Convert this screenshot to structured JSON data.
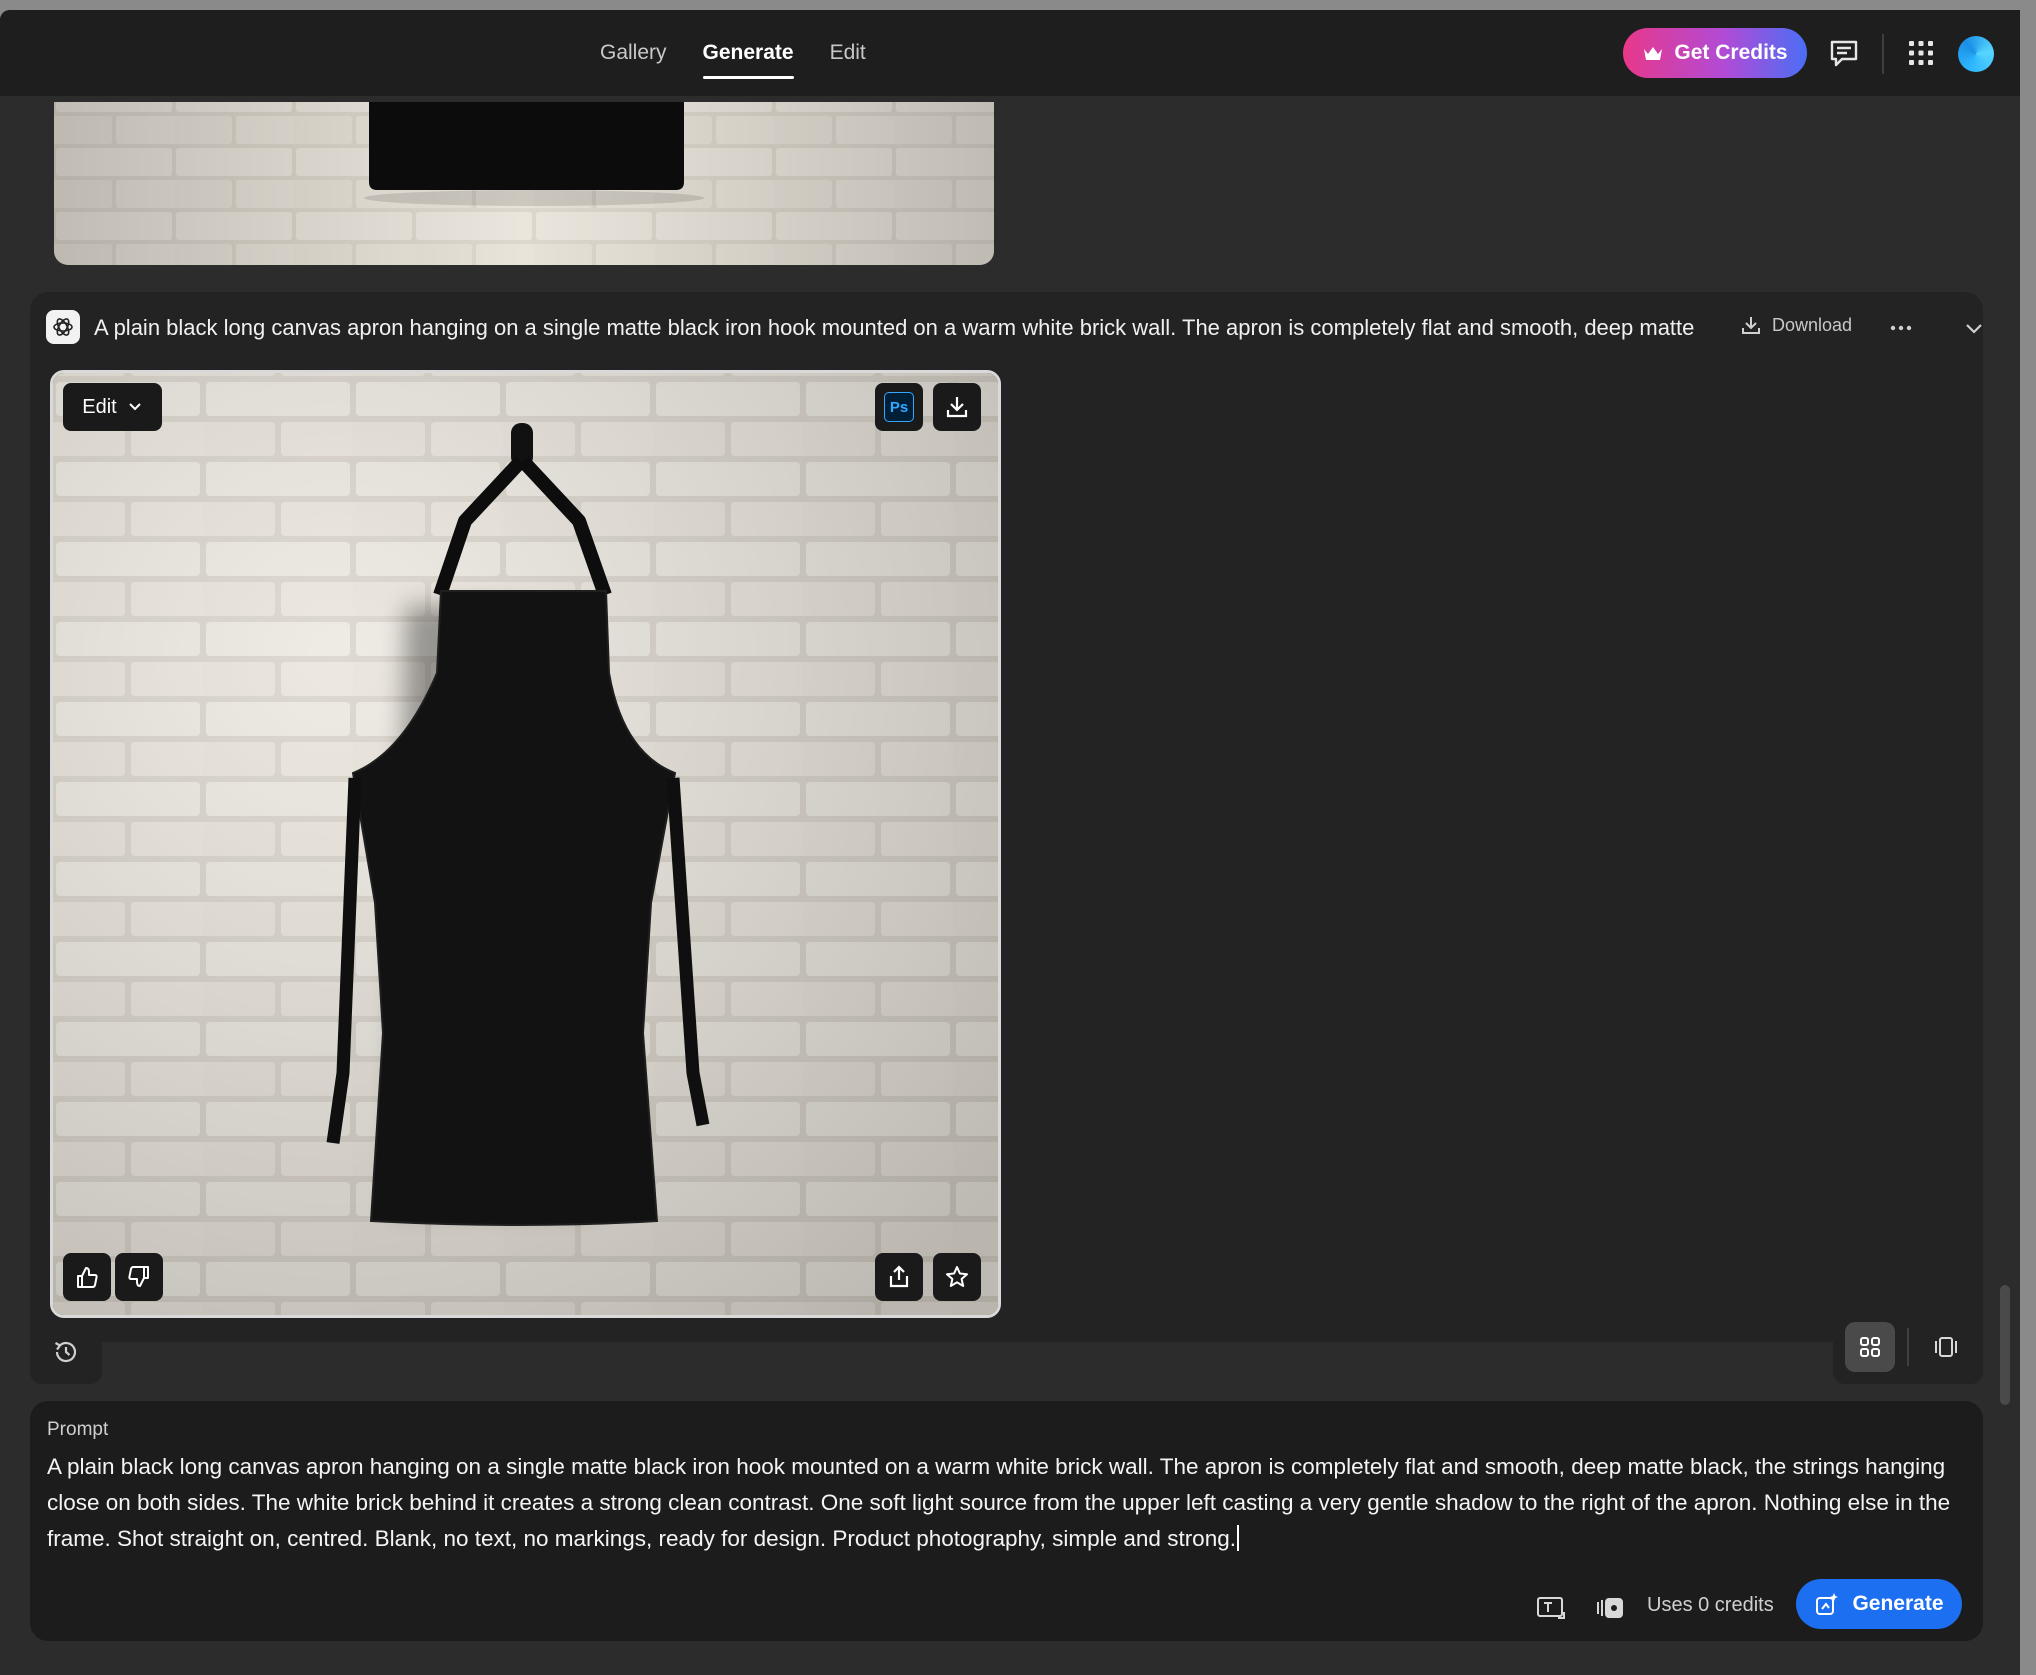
{
  "nav": {
    "tabs": [
      {
        "label": "Gallery",
        "active": false
      },
      {
        "label": "Generate",
        "active": true
      },
      {
        "label": "Edit",
        "active": false
      }
    ]
  },
  "header": {
    "get_credits_label": "Get Credits",
    "icons": [
      "crown-icon",
      "feedback-icon",
      "apps-grid-icon",
      "user-avatar"
    ]
  },
  "result": {
    "title": "A plain black long canvas apron hanging on a single matte black iron hook mounted on a warm white brick wall. The apron is completely flat and smooth, deep matte",
    "download_label": "Download",
    "edit_label": "Edit",
    "ps_label": "Ps"
  },
  "prompt": {
    "label": "Prompt",
    "text": "A plain black long canvas apron hanging on a single matte black iron hook mounted on a warm white brick wall. The apron is completely flat and smooth, deep matte black, the strings hanging close on both sides. The white brick behind it creates a strong clean contrast. One soft light source from the upper left casting a very gentle shadow to the right of the apron. Nothing else in the frame. Shot straight on, centred. Blank, no text, no markings, ready for design. Product photography, simple and strong.",
    "uses_credits": "Uses 0 credits",
    "generate_label": "Generate"
  },
  "colors": {
    "accent_blue": "#1d6ff2",
    "credits_gradient_start": "#e8388a",
    "credits_gradient_end": "#4b6ef5",
    "background": "#2c2c2c",
    "topbar": "#1e1e1e"
  }
}
